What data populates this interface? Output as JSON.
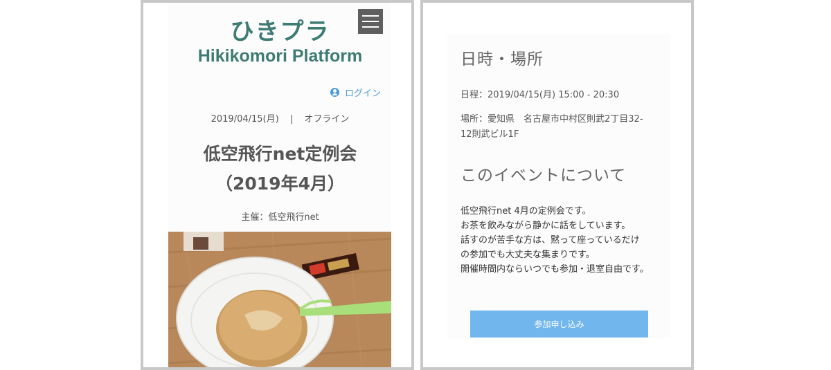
{
  "left": {
    "site_title": "ひきプラ",
    "site_subtitle": "Hikikomori Platform",
    "login_label": "ログイン",
    "event_date": "2019/04/15(月)",
    "separator": "|",
    "event_mode": "オフライン",
    "event_title_line1": "低空飛行net定例会",
    "event_title_line2": "（2019年4月）",
    "organizer": "主催：低空飛行net"
  },
  "right": {
    "datetime_heading": "日時・場所",
    "schedule": "日程：2019/04/15(月) 15:00 - 20:30",
    "location_line1": "場所：愛知県　名古屋市中村区則武2丁目32-",
    "location_line2": "12則武ビル1F",
    "about_heading": "このイベントについて",
    "description": [
      "低空飛行net 4月の定例会です。",
      "お茶を飲みながら静かに話をしています。",
      "話すのが苦手な方は、黙って座っているだけ",
      "の参加でも大丈夫な集まりです。",
      "開催時間内ならいつでも参加・退室自由です。"
    ],
    "apply_label": "参加申し込み"
  },
  "colors": {
    "brand_green": "#3d7b73",
    "link_blue": "#4a9bd6",
    "button_blue": "#72b6ee"
  },
  "icons": [
    "menu-icon",
    "user-icon"
  ]
}
